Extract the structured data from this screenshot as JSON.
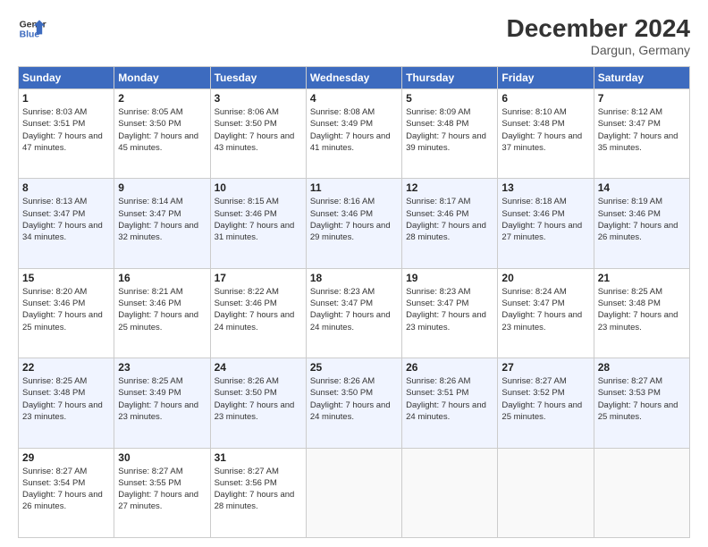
{
  "header": {
    "logo_line1": "General",
    "logo_line2": "Blue",
    "main_title": "December 2024",
    "subtitle": "Dargun, Germany"
  },
  "days_of_week": [
    "Sunday",
    "Monday",
    "Tuesday",
    "Wednesday",
    "Thursday",
    "Friday",
    "Saturday"
  ],
  "weeks": [
    [
      {
        "day": "1",
        "sunrise": "Sunrise: 8:03 AM",
        "sunset": "Sunset: 3:51 PM",
        "daylight": "Daylight: 7 hours and 47 minutes."
      },
      {
        "day": "2",
        "sunrise": "Sunrise: 8:05 AM",
        "sunset": "Sunset: 3:50 PM",
        "daylight": "Daylight: 7 hours and 45 minutes."
      },
      {
        "day": "3",
        "sunrise": "Sunrise: 8:06 AM",
        "sunset": "Sunset: 3:50 PM",
        "daylight": "Daylight: 7 hours and 43 minutes."
      },
      {
        "day": "4",
        "sunrise": "Sunrise: 8:08 AM",
        "sunset": "Sunset: 3:49 PM",
        "daylight": "Daylight: 7 hours and 41 minutes."
      },
      {
        "day": "5",
        "sunrise": "Sunrise: 8:09 AM",
        "sunset": "Sunset: 3:48 PM",
        "daylight": "Daylight: 7 hours and 39 minutes."
      },
      {
        "day": "6",
        "sunrise": "Sunrise: 8:10 AM",
        "sunset": "Sunset: 3:48 PM",
        "daylight": "Daylight: 7 hours and 37 minutes."
      },
      {
        "day": "7",
        "sunrise": "Sunrise: 8:12 AM",
        "sunset": "Sunset: 3:47 PM",
        "daylight": "Daylight: 7 hours and 35 minutes."
      }
    ],
    [
      {
        "day": "8",
        "sunrise": "Sunrise: 8:13 AM",
        "sunset": "Sunset: 3:47 PM",
        "daylight": "Daylight: 7 hours and 34 minutes."
      },
      {
        "day": "9",
        "sunrise": "Sunrise: 8:14 AM",
        "sunset": "Sunset: 3:47 PM",
        "daylight": "Daylight: 7 hours and 32 minutes."
      },
      {
        "day": "10",
        "sunrise": "Sunrise: 8:15 AM",
        "sunset": "Sunset: 3:46 PM",
        "daylight": "Daylight: 7 hours and 31 minutes."
      },
      {
        "day": "11",
        "sunrise": "Sunrise: 8:16 AM",
        "sunset": "Sunset: 3:46 PM",
        "daylight": "Daylight: 7 hours and 29 minutes."
      },
      {
        "day": "12",
        "sunrise": "Sunrise: 8:17 AM",
        "sunset": "Sunset: 3:46 PM",
        "daylight": "Daylight: 7 hours and 28 minutes."
      },
      {
        "day": "13",
        "sunrise": "Sunrise: 8:18 AM",
        "sunset": "Sunset: 3:46 PM",
        "daylight": "Daylight: 7 hours and 27 minutes."
      },
      {
        "day": "14",
        "sunrise": "Sunrise: 8:19 AM",
        "sunset": "Sunset: 3:46 PM",
        "daylight": "Daylight: 7 hours and 26 minutes."
      }
    ],
    [
      {
        "day": "15",
        "sunrise": "Sunrise: 8:20 AM",
        "sunset": "Sunset: 3:46 PM",
        "daylight": "Daylight: 7 hours and 25 minutes."
      },
      {
        "day": "16",
        "sunrise": "Sunrise: 8:21 AM",
        "sunset": "Sunset: 3:46 PM",
        "daylight": "Daylight: 7 hours and 25 minutes."
      },
      {
        "day": "17",
        "sunrise": "Sunrise: 8:22 AM",
        "sunset": "Sunset: 3:46 PM",
        "daylight": "Daylight: 7 hours and 24 minutes."
      },
      {
        "day": "18",
        "sunrise": "Sunrise: 8:23 AM",
        "sunset": "Sunset: 3:47 PM",
        "daylight": "Daylight: 7 hours and 24 minutes."
      },
      {
        "day": "19",
        "sunrise": "Sunrise: 8:23 AM",
        "sunset": "Sunset: 3:47 PM",
        "daylight": "Daylight: 7 hours and 23 minutes."
      },
      {
        "day": "20",
        "sunrise": "Sunrise: 8:24 AM",
        "sunset": "Sunset: 3:47 PM",
        "daylight": "Daylight: 7 hours and 23 minutes."
      },
      {
        "day": "21",
        "sunrise": "Sunrise: 8:25 AM",
        "sunset": "Sunset: 3:48 PM",
        "daylight": "Daylight: 7 hours and 23 minutes."
      }
    ],
    [
      {
        "day": "22",
        "sunrise": "Sunrise: 8:25 AM",
        "sunset": "Sunset: 3:48 PM",
        "daylight": "Daylight: 7 hours and 23 minutes."
      },
      {
        "day": "23",
        "sunrise": "Sunrise: 8:25 AM",
        "sunset": "Sunset: 3:49 PM",
        "daylight": "Daylight: 7 hours and 23 minutes."
      },
      {
        "day": "24",
        "sunrise": "Sunrise: 8:26 AM",
        "sunset": "Sunset: 3:50 PM",
        "daylight": "Daylight: 7 hours and 23 minutes."
      },
      {
        "day": "25",
        "sunrise": "Sunrise: 8:26 AM",
        "sunset": "Sunset: 3:50 PM",
        "daylight": "Daylight: 7 hours and 24 minutes."
      },
      {
        "day": "26",
        "sunrise": "Sunrise: 8:26 AM",
        "sunset": "Sunset: 3:51 PM",
        "daylight": "Daylight: 7 hours and 24 minutes."
      },
      {
        "day": "27",
        "sunrise": "Sunrise: 8:27 AM",
        "sunset": "Sunset: 3:52 PM",
        "daylight": "Daylight: 7 hours and 25 minutes."
      },
      {
        "day": "28",
        "sunrise": "Sunrise: 8:27 AM",
        "sunset": "Sunset: 3:53 PM",
        "daylight": "Daylight: 7 hours and 25 minutes."
      }
    ],
    [
      {
        "day": "29",
        "sunrise": "Sunrise: 8:27 AM",
        "sunset": "Sunset: 3:54 PM",
        "daylight": "Daylight: 7 hours and 26 minutes."
      },
      {
        "day": "30",
        "sunrise": "Sunrise: 8:27 AM",
        "sunset": "Sunset: 3:55 PM",
        "daylight": "Daylight: 7 hours and 27 minutes."
      },
      {
        "day": "31",
        "sunrise": "Sunrise: 8:27 AM",
        "sunset": "Sunset: 3:56 PM",
        "daylight": "Daylight: 7 hours and 28 minutes."
      },
      null,
      null,
      null,
      null
    ]
  ]
}
